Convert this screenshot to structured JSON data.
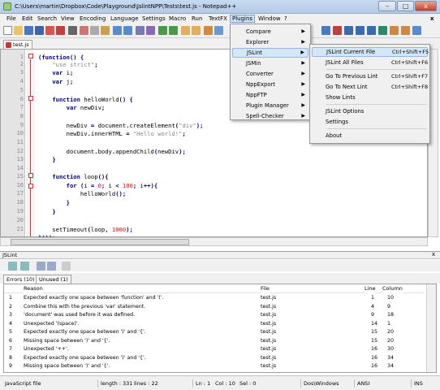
{
  "window": {
    "title": "C:\\Users\\martin\\Dropbox\\Code\\Playground\\JslintNPP\\Tests\\test.js - Notepad++",
    "min": "–",
    "max": "□",
    "close": "x"
  },
  "menubar": [
    "File",
    "Edit",
    "Search",
    "View",
    "Encoding",
    "Language",
    "Settings",
    "Macro",
    "Run",
    "TextFX",
    "Plugins",
    "Window",
    "?"
  ],
  "tab": "test.js",
  "editor": {
    "lines": [
      "1",
      "2",
      "3",
      "4",
      "5",
      "6",
      "7",
      "8",
      "9",
      "10",
      "11",
      "12",
      "13",
      "14",
      "15",
      "16",
      "17",
      "18",
      "19",
      "20",
      "21"
    ]
  },
  "plugins_menu": {
    "items": [
      "Compare",
      "Explorer",
      "JSLint",
      "JSMin",
      "Converter",
      "NppExport",
      "NppFTP",
      "Plugin Manager",
      "Spell-Checker"
    ]
  },
  "jslint_menu": {
    "items": [
      {
        "label": "JSLint Current File",
        "shortcut": "Ctrl+Shift+F5"
      },
      {
        "label": "JSLint All Files",
        "shortcut": "Ctrl+Shift+F6"
      },
      {
        "label": "Go To Previous Lint",
        "shortcut": "Ctrl+Shift+F7"
      },
      {
        "label": "Go To Next Lint",
        "shortcut": "Ctrl+Shift+F8"
      },
      {
        "label": "Show Lints",
        "shortcut": ""
      },
      {
        "label": "JSLint Options",
        "shortcut": ""
      },
      {
        "label": "Settings",
        "shortcut": ""
      },
      {
        "label": "About",
        "shortcut": ""
      }
    ]
  },
  "panel": {
    "title": "JSLint",
    "tabs": [
      "Errors (10)",
      "Unused (1)"
    ],
    "columns": [
      "Reason",
      "File",
      "Line",
      "Column"
    ],
    "rows": [
      [
        "1",
        "Expected exactly one space between 'function' and '('.",
        "test.js",
        "1",
        "10"
      ],
      [
        "2",
        "Combine this with the previous 'var' statement.",
        "test.js",
        "4",
        "9"
      ],
      [
        "3",
        "'document' was used before it was defined.",
        "test.js",
        "9",
        "18"
      ],
      [
        "4",
        "Unexpected '(space)'.",
        "test.js",
        "14",
        "1"
      ],
      [
        "5",
        "Expected exactly one space between ')' and '{'.",
        "test.js",
        "15",
        "20"
      ],
      [
        "6",
        "Missing space between ')' and '{'.",
        "test.js",
        "15",
        "20"
      ],
      [
        "7",
        "Unexpected '++'.",
        "test.js",
        "16",
        "30"
      ],
      [
        "8",
        "Expected exactly one space between ')' and '{'.",
        "test.js",
        "16",
        "34"
      ],
      [
        "9",
        "Missing space between ')' and '{'.",
        "test.js",
        "16",
        "34"
      ]
    ]
  },
  "status": {
    "type": "JavaScript file",
    "length": "length : 331",
    "lines": "lines : 22",
    "ln": "Ln : 1",
    "col": "Col : 10",
    "sel": "Sel : 0",
    "eol": "Dos\\Windows",
    "enc": "ANSI",
    "mode": "INS"
  }
}
